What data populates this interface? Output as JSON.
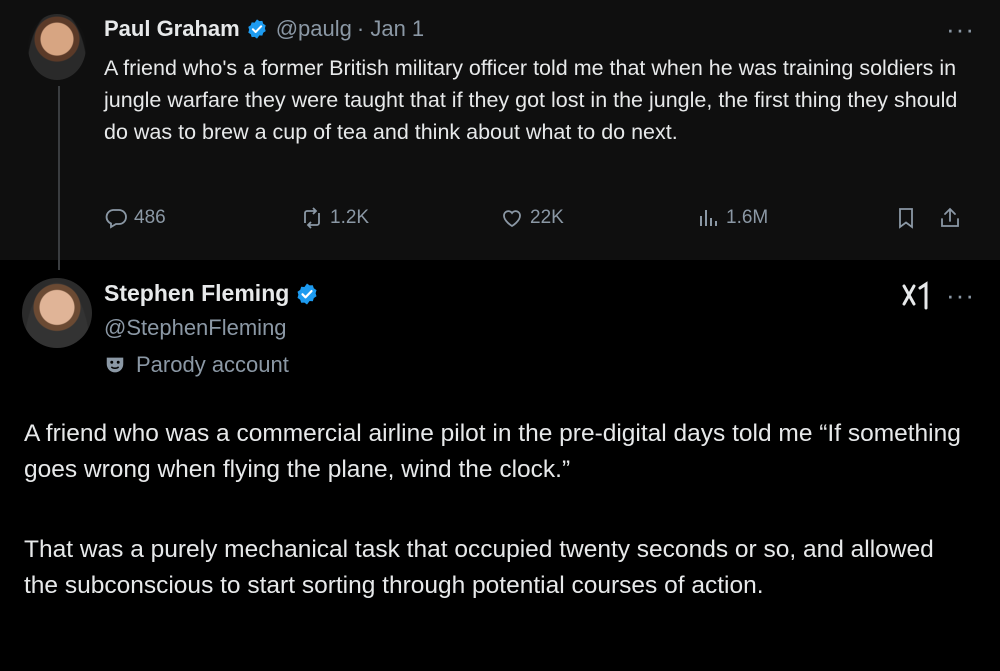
{
  "quoted_tweet": {
    "author_name": "Paul Graham",
    "handle": "@paulg",
    "date": "· Jan 1",
    "text": "A friend who's a former British military officer told me that when he was training soldiers in jungle warfare they were taught that if they got lost in the jungle, the first thing they should do was to brew a cup of tea and think about what to do next.",
    "replies": "486",
    "reposts": "1.2K",
    "likes": "22K",
    "views": "1.6M"
  },
  "reply_tweet": {
    "author_name": "Stephen Fleming",
    "handle": "@StephenFleming",
    "label": "Parody account",
    "paragraph_1": "A friend who was a commercial airline pilot in the pre-digital days told me “If something goes wrong when flying the plane, wind the clock.”",
    "paragraph_2": "That was a purely mechanical task that occupied twenty seconds or so, and allowed the subconscious to start sorting through potential courses of action."
  },
  "icons": {
    "verified": "verified-badge-icon",
    "more": "more-icon",
    "reply": "reply-icon",
    "repost": "repost-icon",
    "like": "heart-icon",
    "views": "views-icon",
    "bookmark": "bookmark-icon",
    "share": "share-icon",
    "parody": "theater-mask-icon",
    "grok": "grok-icon"
  },
  "colors": {
    "verified": "#1d9bf0",
    "secondary_text": "#8b98a5"
  }
}
